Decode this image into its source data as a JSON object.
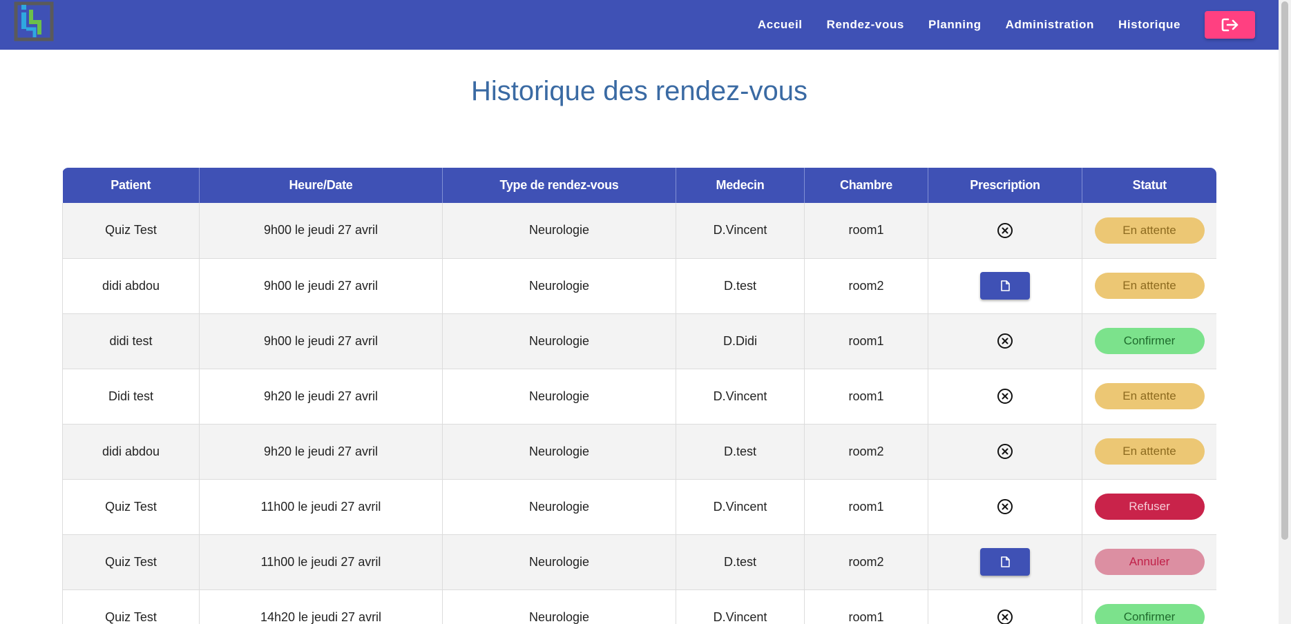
{
  "nav": {
    "items": [
      {
        "label": "Accueil"
      },
      {
        "label": "Rendez-vous"
      },
      {
        "label": "Planning"
      },
      {
        "label": "Administration"
      },
      {
        "label": "Historique"
      }
    ],
    "logout_icon": "sign-out-icon"
  },
  "page": {
    "title": "Historique des rendez-vous"
  },
  "table": {
    "headers": [
      "Patient",
      "Heure/Date",
      "Type de rendez-vous",
      "Medecin",
      "Chambre",
      "Prescription",
      "Statut"
    ],
    "rows": [
      {
        "patient": "Quiz Test",
        "datetime": "9h00 le jeudi 27 avril",
        "type": "Neurologie",
        "medecin": "D.Vincent",
        "chambre": "room1",
        "prescription": "none",
        "statut": "En attente",
        "statut_kind": "attente"
      },
      {
        "patient": "didi abdou",
        "datetime": "9h00 le jeudi 27 avril",
        "type": "Neurologie",
        "medecin": "D.test",
        "chambre": "room2",
        "prescription": "file",
        "statut": "En attente",
        "statut_kind": "attente"
      },
      {
        "patient": "didi test",
        "datetime": "9h00 le jeudi 27 avril",
        "type": "Neurologie",
        "medecin": "D.Didi",
        "chambre": "room1",
        "prescription": "none",
        "statut": "Confirmer",
        "statut_kind": "confirmer"
      },
      {
        "patient": "Didi test",
        "datetime": "9h20 le jeudi 27 avril",
        "type": "Neurologie",
        "medecin": "D.Vincent",
        "chambre": "room1",
        "prescription": "none",
        "statut": "En attente",
        "statut_kind": "attente"
      },
      {
        "patient": "didi abdou",
        "datetime": "9h20 le jeudi 27 avril",
        "type": "Neurologie",
        "medecin": "D.test",
        "chambre": "room2",
        "prescription": "none",
        "statut": "En attente",
        "statut_kind": "attente"
      },
      {
        "patient": "Quiz Test",
        "datetime": "11h00 le jeudi 27 avril",
        "type": "Neurologie",
        "medecin": "D.Vincent",
        "chambre": "room1",
        "prescription": "none",
        "statut": "Refuser",
        "statut_kind": "refuser"
      },
      {
        "patient": "Quiz Test",
        "datetime": "11h00 le jeudi 27 avril",
        "type": "Neurologie",
        "medecin": "D.test",
        "chambre": "room2",
        "prescription": "file",
        "statut": "Annuler",
        "statut_kind": "annuler"
      },
      {
        "patient": "Quiz Test",
        "datetime": "14h20 le jeudi 27 avril",
        "type": "Neurologie",
        "medecin": "D.Vincent",
        "chambre": "room1",
        "prescription": "none",
        "statut": "Confirmer",
        "statut_kind": "confirmer"
      }
    ]
  },
  "colors": {
    "primary": "#3f51b5",
    "accent": "#ff4081",
    "title": "#3a6aa3",
    "attente": "#ecc774",
    "confirmer": "#7ce28c",
    "refuser": "#c9234a",
    "annuler": "#dc8fa2"
  }
}
